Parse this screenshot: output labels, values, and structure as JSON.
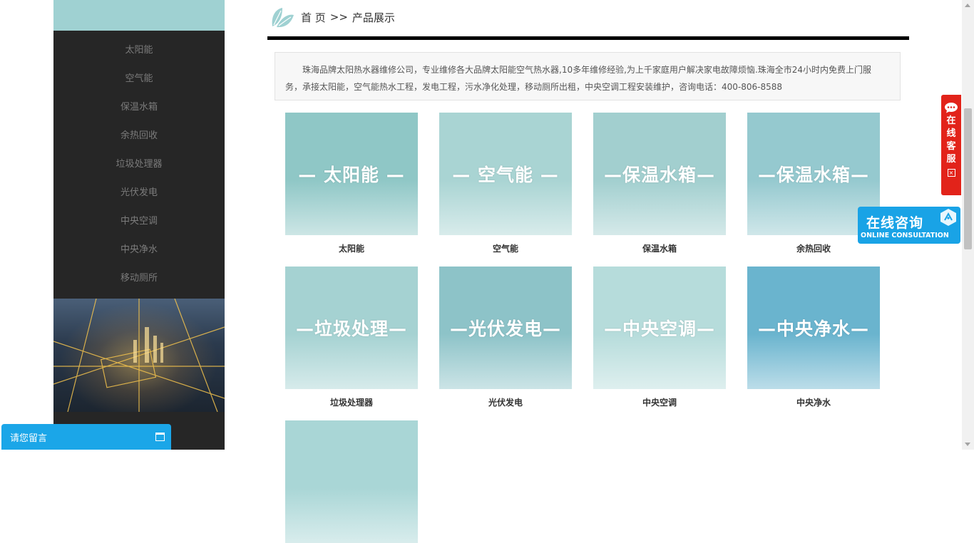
{
  "breadcrumb": {
    "home": "首 页",
    "separator": ">>",
    "current": "产品展示"
  },
  "sidebar": {
    "items": [
      {
        "label": "太阳能"
      },
      {
        "label": "空气能"
      },
      {
        "label": "保温水箱"
      },
      {
        "label": "余热回收"
      },
      {
        "label": "垃圾处理器"
      },
      {
        "label": "光伏发电"
      },
      {
        "label": "中央空调"
      },
      {
        "label": "中央净水"
      },
      {
        "label": "移动厕所"
      }
    ]
  },
  "intro": {
    "text": "珠海品牌太阳热水器维修公司，专业维修各大品牌太阳能空气热水器,10多年维修经验,为上千家庭用户解决家电故障烦恼.珠海全市24小时内免费上门服务，承接太阳能，空气能热水工程，发电工程，污水净化处理，移动厕所出租，中央空调工程安装维护，咨询电话：400-806-8588"
  },
  "products": [
    {
      "overlay": "— 太阳能 —",
      "caption": "太阳能",
      "bg": "#8fc7c6"
    },
    {
      "overlay": "— 空气能 —",
      "caption": "空气能",
      "bg": "#a9d4d3"
    },
    {
      "overlay": "—保温水箱—",
      "caption": "保温水箱",
      "bg": "#a2cfcf"
    },
    {
      "overlay": "—保温水箱—",
      "caption": "余热回收",
      "bg": "#95c9cf"
    },
    {
      "overlay": "—垃圾处理—",
      "caption": "垃圾处理器",
      "bg": "#a5d2d2"
    },
    {
      "overlay": "—光伏发电—",
      "caption": "光伏发电",
      "bg": "#8dc3c8"
    },
    {
      "overlay": "—中央空调—",
      "caption": "中央空调",
      "bg": "#b6dcdb"
    },
    {
      "overlay": "—中央净水—",
      "caption": "中央净水",
      "bg": "#6ab4ce"
    },
    {
      "overlay": "",
      "caption": "",
      "bg": "#a9d6d6"
    }
  ],
  "service": {
    "vertical_label": "在线客服",
    "close_glyph": "×"
  },
  "consult": {
    "title": "在线咨询",
    "subtitle": "ONLINE CONSULTATION"
  },
  "message": {
    "label": "请您留言"
  },
  "colors": {
    "sidebar_bg": "#262626",
    "sidebar_accent": "#9fd1d2",
    "service_red": "#e2231a",
    "consult_blue": "#19a3e6"
  }
}
